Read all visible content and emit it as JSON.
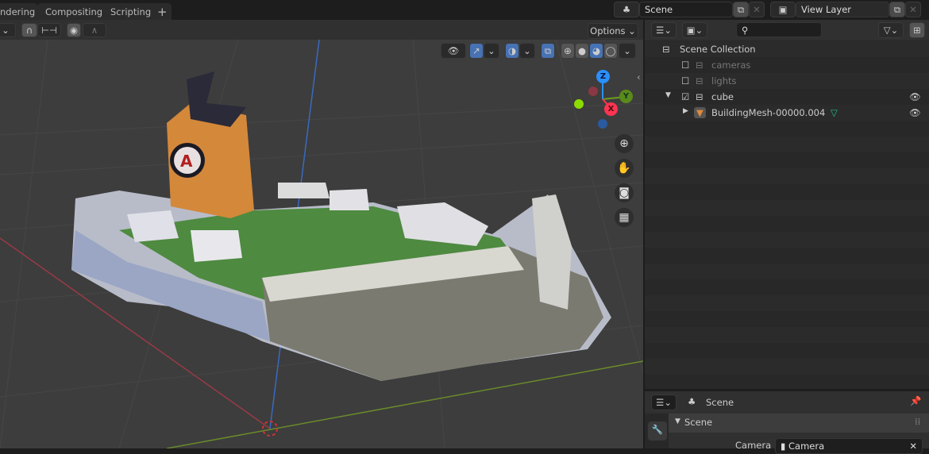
{
  "workspace_tabs": [
    {
      "label": "ndering"
    },
    {
      "label": "Compositing"
    },
    {
      "label": "Scripting"
    },
    {
      "label": "+"
    }
  ],
  "scene_selector": {
    "value": "Scene"
  },
  "view_layer_selector": {
    "value": "View Layer"
  },
  "viewport": {
    "options_label": "Options",
    "gizmo": {
      "z": "Z",
      "y": "Y",
      "x": "X"
    },
    "colors": {
      "x": "#ff3352",
      "y": "#8bdc00",
      "z": "#2890ff"
    }
  },
  "outliner": {
    "search_placeholder": "",
    "root": "Scene Collection",
    "items": [
      {
        "label": "cameras",
        "checked": false,
        "dim": true
      },
      {
        "label": "lights",
        "checked": false,
        "dim": true
      },
      {
        "label": "cube",
        "checked": true,
        "dim": false
      },
      {
        "label": "BuildingMesh-00000.004"
      }
    ]
  },
  "properties": {
    "context": "Scene",
    "panel_title": "Scene",
    "camera_label": "Camera",
    "camera_value": "Camera"
  }
}
